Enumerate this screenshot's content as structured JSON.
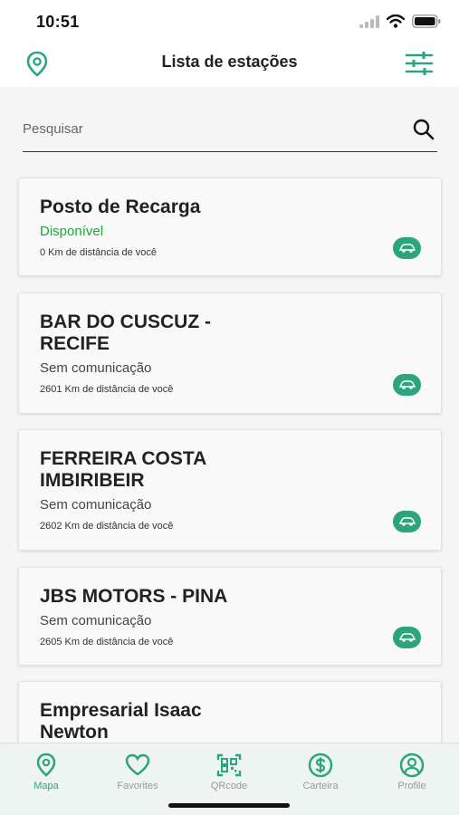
{
  "status_bar": {
    "time": "10:51"
  },
  "nav": {
    "title": "Lista de estações",
    "left_icon": "location-pin-icon",
    "right_icon": "filter-sliders-icon"
  },
  "search": {
    "placeholder": "Pesquisar",
    "value": "",
    "icon": "search-icon"
  },
  "stations": [
    {
      "name": "Posto de Recarga",
      "status": "Disponível",
      "distance": "0 Km de distância de você",
      "available": true
    },
    {
      "name": "BAR DO CUSCUZ - RECIFE",
      "status": "Sem comunicação",
      "distance": "2601 Km de distância de você",
      "available": false
    },
    {
      "name": "FERREIRA COSTA IMBIRIBEIR",
      "status": "Sem comunicação",
      "distance": "2602 Km de distância de você",
      "available": false
    },
    {
      "name": "JBS MOTORS - PINA",
      "status": "Sem comunicação",
      "distance": "2605 Km de distância de você",
      "available": false
    },
    {
      "name": "Empresarial Isaac Newton",
      "status": "",
      "distance": "",
      "available": false
    }
  ],
  "tabs": [
    {
      "label": "Mapa",
      "icon": "map-pin-icon",
      "active": true
    },
    {
      "label": "Favorites",
      "icon": "heart-icon",
      "active": false
    },
    {
      "label": "QRcode",
      "icon": "qrcode-icon",
      "active": false
    },
    {
      "label": "Carteira",
      "icon": "dollar-icon",
      "active": false
    },
    {
      "label": "Profile",
      "icon": "profile-icon",
      "active": false
    }
  ],
  "colors": {
    "accent": "#2ba57a",
    "available": "#1aa83b",
    "background": "#f5f5f5"
  }
}
